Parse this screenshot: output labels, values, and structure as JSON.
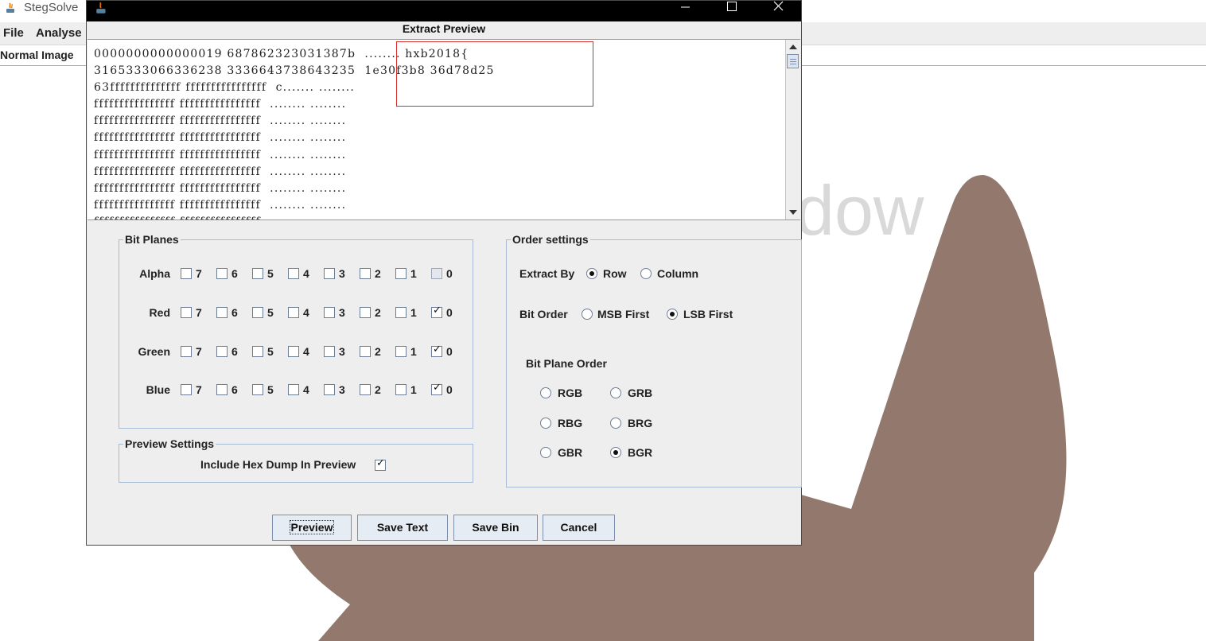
{
  "main_window": {
    "title": "StegSolve",
    "menu": [
      "File",
      "Analyse"
    ],
    "image_label": "Normal Image",
    "bg_text": "dow"
  },
  "dialog": {
    "heading": "Extract Preview",
    "hex_lines": [
      "0000000000000019 687862323031387b  ........ hxb2018{",
      "3165333066336238 3336643738643235  1e30f3b8 36d78d25",
      "63ffffffffffffff ffffffffffffffff  c....... ........",
      "ffffffffffffffff ffffffffffffffff  ........ ........",
      "ffffffffffffffff ffffffffffffffff  ........ ........",
      "ffffffffffffffff ffffffffffffffff  ........ ........",
      "ffffffffffffffff ffffffffffffffff  ........ ........",
      "ffffffffffffffff ffffffffffffffff  ........ ........",
      "ffffffffffffffff ffffffffffffffff  ........ ........",
      "ffffffffffffffff ffffffffffffffff  ........ ........",
      "ffffffffffffffff ffffffffffffffff  ........ ........"
    ],
    "bit_planes": {
      "legend": "Bit Planes",
      "bits": [
        "7",
        "6",
        "5",
        "4",
        "3",
        "2",
        "1",
        "0"
      ],
      "channels": [
        {
          "name": "Alpha",
          "checked": [
            false,
            false,
            false,
            false,
            false,
            false,
            false,
            false
          ],
          "disabled_bit0": true
        },
        {
          "name": "Red",
          "checked": [
            false,
            false,
            false,
            false,
            false,
            false,
            false,
            true
          ]
        },
        {
          "name": "Green",
          "checked": [
            false,
            false,
            false,
            false,
            false,
            false,
            false,
            true
          ]
        },
        {
          "name": "Blue",
          "checked": [
            false,
            false,
            false,
            false,
            false,
            false,
            false,
            true
          ]
        }
      ]
    },
    "preview_settings": {
      "legend": "Preview Settings",
      "hex_dump_label": "Include Hex Dump In Preview",
      "hex_dump_checked": true
    },
    "order_settings": {
      "legend": "Order settings",
      "extract_by_label": "Extract By",
      "extract_by_options": [
        "Row",
        "Column"
      ],
      "extract_by_selected": "Row",
      "bit_order_label": "Bit Order",
      "bit_order_options": [
        "MSB First",
        "LSB First"
      ],
      "bit_order_selected": "LSB First",
      "plane_order_label": "Bit Plane Order",
      "plane_order_options": [
        "RGB",
        "GRB",
        "RBG",
        "BRG",
        "GBR",
        "BGR"
      ],
      "plane_order_selected": "BGR"
    },
    "buttons": {
      "preview": "Preview",
      "save_text": "Save Text",
      "save_bin": "Save Bin",
      "cancel": "Cancel"
    }
  },
  "colors": {
    "titlebar": "#000000",
    "dialog_bg": "#eeeeee",
    "highlight_border": "#d32f2f",
    "shape_fill": "#93796d"
  }
}
